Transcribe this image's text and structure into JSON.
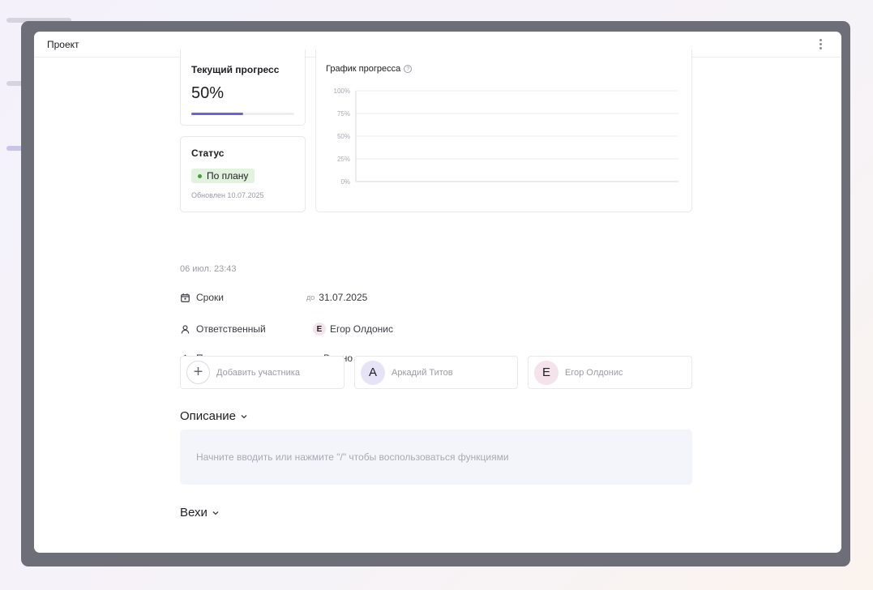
{
  "modal": {
    "title": "Проект"
  },
  "progress_card": {
    "label": "Текущий прогресс",
    "value_text": "50%",
    "value": 0.5,
    "accent": "#6b63d6"
  },
  "status_card": {
    "label": "Статус",
    "badge": "По плану",
    "badge_color": "#e3f1df",
    "dot_color": "#4c9a3a",
    "updated": "Обновлен 10.07.2025"
  },
  "chart_card": {
    "title": "График прогресса",
    "help_icon": "help-circle-icon"
  },
  "chart_data": {
    "type": "line",
    "title": "График прогресса",
    "yticks": [
      "100%",
      "75%",
      "50%",
      "25%",
      "0%"
    ],
    "ylim": [
      0,
      100
    ],
    "series": [],
    "grid": true
  },
  "created": "06 июл. 23:43",
  "properties": {
    "deadline": {
      "icon": "calendar-icon",
      "label": "Сроки",
      "prefix": "до",
      "value": "31.07.2025"
    },
    "assignee": {
      "icon": "user-icon",
      "label": "Ответственный",
      "avatar": "Е",
      "value": "Егор Олдонис"
    },
    "priority": {
      "icon": "diamond-icon",
      "label": "Приоритет",
      "value": "Важно",
      "dot_color": "#7a5bd2"
    }
  },
  "members": {
    "add_label": "Добавить участника",
    "list": [
      {
        "initial": "А",
        "name": "Аркадий Титов"
      },
      {
        "initial": "Е",
        "name": "Егор Олдонис"
      }
    ]
  },
  "description": {
    "title": "Описание",
    "placeholder": "Начните вводить или нажмите \"/\" чтобы воспользоваться функциями"
  },
  "milestones": {
    "title": "Вехи"
  }
}
